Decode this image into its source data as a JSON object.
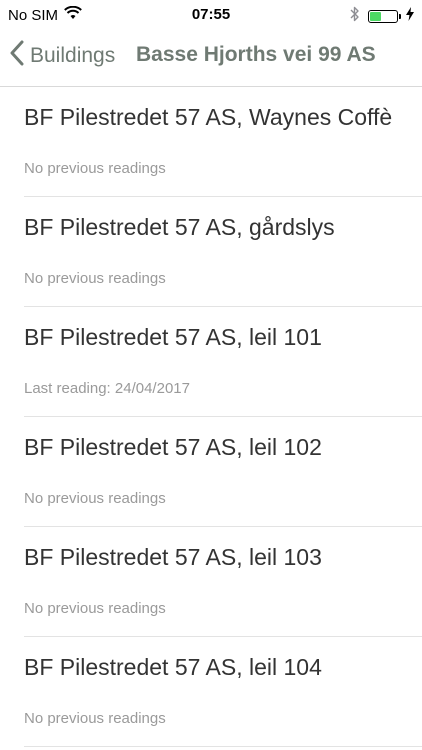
{
  "status_bar": {
    "carrier": "No SIM",
    "time": "07:55",
    "battery_level": 0.45
  },
  "nav": {
    "back_label": "Buildings",
    "title": "Basse Hjorths vei 99 AS"
  },
  "items": [
    {
      "title": "BF Pilestredet 57 AS, Waynes Coffè",
      "subtitle": "No previous readings"
    },
    {
      "title": "BF Pilestredet 57 AS, gårdslys",
      "subtitle": "No previous readings"
    },
    {
      "title": "BF Pilestredet 57 AS, leil 101",
      "subtitle": "Last reading: 24/04/2017"
    },
    {
      "title": "BF Pilestredet 57 AS, leil 102",
      "subtitle": "No previous readings"
    },
    {
      "title": "BF Pilestredet 57 AS, leil 103",
      "subtitle": "No previous readings"
    },
    {
      "title": "BF Pilestredet 57 AS, leil 104",
      "subtitle": "No previous readings"
    }
  ],
  "colors": {
    "accent": "#6f7a73",
    "battery": "#4cd964"
  }
}
